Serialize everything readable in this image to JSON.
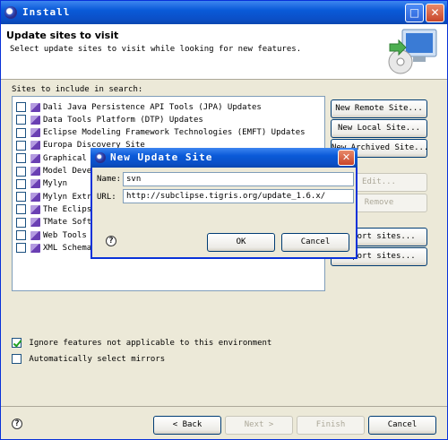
{
  "window": {
    "title": "Install"
  },
  "header": {
    "title": "Update sites to visit",
    "subtitle": "Select update sites to visit while looking for new features."
  },
  "sites_label": "Sites to include in search:",
  "sites": [
    {
      "label": "Dali Java Persistence API Tools (JPA) Updates",
      "checked": false
    },
    {
      "label": "Data Tools Platform (DTP) Updates",
      "checked": false
    },
    {
      "label": "Eclipse Modeling Framework Technologies (EMFT) Updates",
      "checked": false
    },
    {
      "label": "Europa Discovery Site",
      "checked": false
    },
    {
      "label": "Graphical",
      "checked": false
    },
    {
      "label": "Model Deve",
      "checked": false
    },
    {
      "label": "Mylyn",
      "checked": false
    },
    {
      "label": "Mylyn Extr",
      "checked": false
    },
    {
      "label": "The Eclips",
      "checked": false
    },
    {
      "label": "TMate Soft",
      "checked": false
    },
    {
      "label": "Web Tools",
      "checked": false
    },
    {
      "label": "XML Schema",
      "checked": false
    }
  ],
  "side_buttons": {
    "new_remote": "New Remote Site...",
    "new_local": "New Local Site...",
    "new_archived": "New Archived Site...",
    "edit": "Edit...",
    "remove": "Remove",
    "import": "Import sites...",
    "export": "Export sites..."
  },
  "options": {
    "ignore_label": "Ignore features not applicable to this environment",
    "ignore_checked": true,
    "mirrors_label": "Automatically select mirrors",
    "mirrors_checked": false
  },
  "footer": {
    "back": "< Back",
    "next": "Next >",
    "finish": "Finish",
    "cancel": "Cancel"
  },
  "dialog": {
    "title": "New Update Site",
    "name_label": "Name:",
    "name_value": "svn",
    "url_label": "URL:",
    "url_value": "http://subclipse.tigris.org/update_1.6.x/",
    "ok": "OK",
    "cancel": "Cancel",
    "help_glyph": "?"
  },
  "help_glyph": "?"
}
